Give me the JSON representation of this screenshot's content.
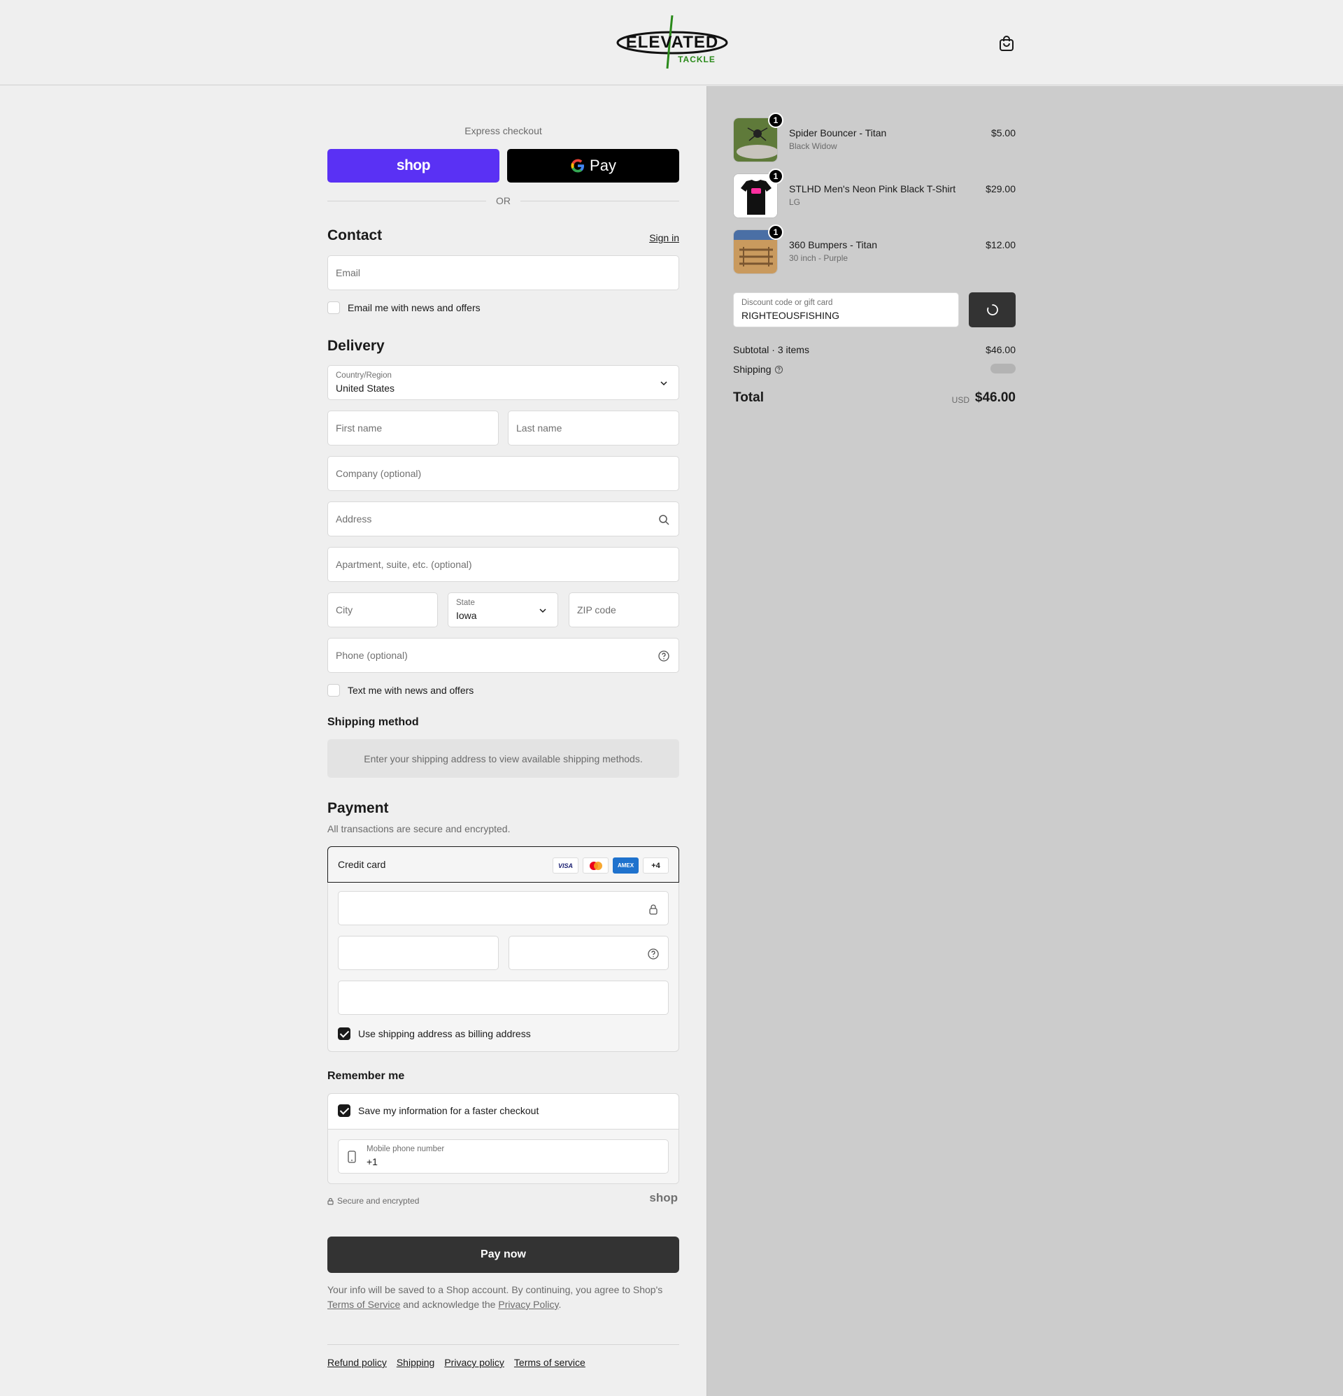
{
  "brand": {
    "logo_main": "ELEVATED",
    "logo_sub": "TACKLE"
  },
  "express": {
    "label": "Express checkout",
    "shop_label": "shop",
    "gpay_label": "Pay",
    "or": "OR"
  },
  "contact": {
    "title": "Contact",
    "sign_in": "Sign in",
    "email_placeholder": "Email",
    "news_label": "Email me with news and offers"
  },
  "delivery": {
    "title": "Delivery",
    "country_label": "Country/Region",
    "country_value": "United States",
    "first_name": "First name",
    "last_name": "Last name",
    "company": "Company (optional)",
    "address": "Address",
    "apartment": "Apartment, suite, etc. (optional)",
    "city": "City",
    "state_label": "State",
    "state_value": "Iowa",
    "zip": "ZIP code",
    "phone": "Phone (optional)",
    "text_label": "Text me with news and offers"
  },
  "shipping_method": {
    "title": "Shipping method",
    "message": "Enter your shipping address to view available shipping methods."
  },
  "payment": {
    "title": "Payment",
    "subtitle": "All transactions are secure and encrypted.",
    "method": "Credit card",
    "cards": [
      "VISA",
      "MC",
      "AMEX",
      "+4"
    ],
    "billing_label": "Use shipping address as billing address"
  },
  "remember": {
    "title": "Remember me",
    "save_label": "Save my information for a faster checkout",
    "phone_label": "Mobile phone number",
    "phone_value": "+1",
    "secure": "Secure and encrypted",
    "shop": "shop"
  },
  "pay_button": "Pay now",
  "legal": {
    "line1": "Your info will be saved to a Shop account. By continuing, you agree to Shop's",
    "tos": "Terms of Service",
    "mid": "and acknowledge the",
    "privacy": "Privacy Policy",
    "end": "."
  },
  "footer": [
    "Refund policy",
    "Shipping",
    "Privacy policy",
    "Terms of service"
  ],
  "order": {
    "items": [
      {
        "name": "Spider Bouncer - Titan",
        "variant": "Black Widow",
        "price": "$5.00",
        "qty": "1"
      },
      {
        "name": "STLHD Men's Neon Pink Black T-Shirt",
        "variant": "LG",
        "price": "$29.00",
        "qty": "1"
      },
      {
        "name": "360 Bumpers - Titan",
        "variant": "30 inch - Purple",
        "price": "$12.00",
        "qty": "1"
      }
    ],
    "discount_label": "Discount code or gift card",
    "discount_value": "RIGHTEOUSFISHING",
    "subtotal_label": "Subtotal · 3 items",
    "subtotal_value": "$46.00",
    "shipping_label": "Shipping",
    "total_label": "Total",
    "currency": "USD",
    "total_value": "$46.00"
  }
}
